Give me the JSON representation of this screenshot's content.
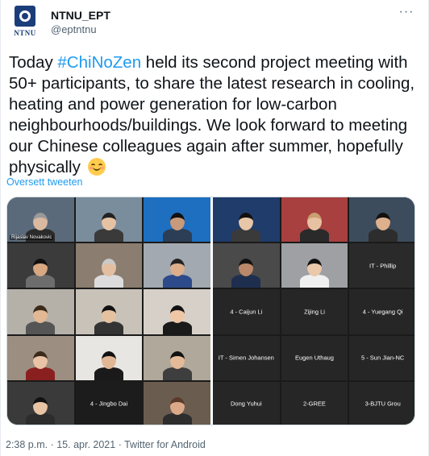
{
  "account": {
    "display_name": "NTNU_EPT",
    "handle": "@eptntnu",
    "logo_text": "NTNU",
    "logo_color": "#1b3d7a"
  },
  "header": {
    "more_icon": "more-horizontal-icon",
    "more_glyph": "···"
  },
  "tweet": {
    "text_before": "Today ",
    "hashtag": "#ChiNoZen",
    "text_after": " held its second project meeting with 50+ participants, to share the latest research in cooling, heating and power generation for low-carbon neighbourhoods/buildings. We look forward to meeting our Chinese colleagues again after summer, hopefully physically ",
    "emoji": "smiling-face-with-smiling-eyes",
    "translate_label": "Oversett tweeten"
  },
  "media": {
    "left_grid": {
      "tiles": [
        {
          "caption": "Rijaslav Novakovic"
        },
        {
          "caption": ""
        },
        {
          "caption": ""
        },
        {
          "caption": ""
        },
        {
          "caption": ""
        },
        {
          "caption": ""
        },
        {
          "caption": ""
        },
        {
          "caption": ""
        },
        {
          "caption": ""
        },
        {
          "caption": ""
        },
        {
          "caption": ""
        },
        {
          "caption": ""
        },
        {
          "caption": ""
        },
        {
          "caption": "4 - Jingbo Dai"
        },
        {
          "caption": ""
        }
      ]
    },
    "right_grid": {
      "tiles": [
        {
          "caption": ""
        },
        {
          "caption": ""
        },
        {
          "caption": ""
        },
        {
          "caption": ""
        },
        {
          "caption": ""
        },
        {
          "caption": "IT - Phillip"
        },
        {
          "caption": "4 - Caijun Li"
        },
        {
          "caption": "Zijing Li"
        },
        {
          "caption": "4 - Yuegang Qi"
        },
        {
          "caption": "IT - Simen Johansen"
        },
        {
          "caption": "Eugen Uthaug"
        },
        {
          "caption": "5 - Sun Jian-NC"
        },
        {
          "caption": "Dong Yuhui"
        },
        {
          "caption": "2-GREE"
        },
        {
          "caption": "3-BJTU Grou"
        }
      ]
    }
  },
  "footer": {
    "time": "2:38 p.m.",
    "separator": " · ",
    "date": "15. apr. 2021",
    "source": "Twitter for Android"
  },
  "colors": {
    "link": "#1d9bf0",
    "text": "#0f1419",
    "muted": "#536471"
  }
}
